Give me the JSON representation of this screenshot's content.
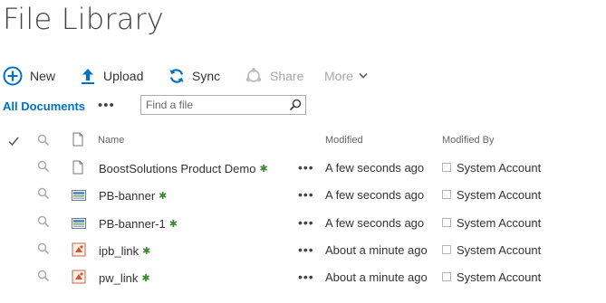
{
  "page": {
    "title": "File Library"
  },
  "commands": {
    "new": "New",
    "upload": "Upload",
    "sync": "Sync",
    "share": "Share",
    "more": "More"
  },
  "view": {
    "current": "All Documents",
    "ellipsis": "•••",
    "search_placeholder": "Find a file"
  },
  "columns": {
    "name": "Name",
    "modified": "Modified",
    "modified_by": "Modified By"
  },
  "rows": [
    {
      "name": "BoostSolutions Product Demo",
      "type": "document-icon",
      "modified": "A few seconds ago",
      "modified_by": "System Account"
    },
    {
      "name": "PB-banner",
      "type": "image-icon",
      "modified": "A few seconds ago",
      "modified_by": "System Account"
    },
    {
      "name": "PB-banner-1",
      "type": "image-icon",
      "modified": "A few seconds ago",
      "modified_by": "System Account"
    },
    {
      "name": "ipb_link",
      "type": "link-icon",
      "modified": "About a minute ago",
      "modified_by": "System Account"
    },
    {
      "name": "pw_link",
      "type": "link-icon",
      "modified": "About a minute ago",
      "modified_by": "System Account"
    }
  ],
  "colors": {
    "accent": "#0072c6",
    "new_marker": "#3c8a2e",
    "disabled": "#a6a6a6"
  }
}
